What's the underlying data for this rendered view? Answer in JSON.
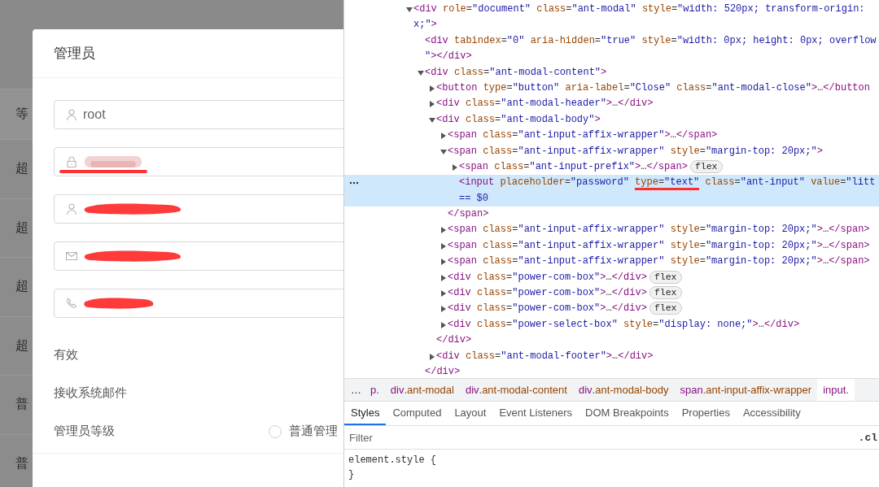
{
  "page_behind": {
    "header_cell": "等",
    "row_cells": [
      "超",
      "超",
      "超",
      "超",
      "普",
      "普"
    ]
  },
  "modal": {
    "title": "管理员",
    "fields": [
      {
        "kind": "user",
        "value": "root",
        "redacted": false,
        "underlined": false
      },
      {
        "kind": "lock",
        "redacted": true,
        "underlined": true
      },
      {
        "kind": "user",
        "redacted": true,
        "underlined": false
      },
      {
        "kind": "mail",
        "redacted": true,
        "underlined": false
      },
      {
        "kind": "phone",
        "redacted": true,
        "underlined": false
      }
    ],
    "options": [
      {
        "label": "有效"
      },
      {
        "label": "接收系统邮件"
      }
    ],
    "level": {
      "label": "管理员等级",
      "radios": [
        {
          "label": "普通管理",
          "checked": false
        }
      ]
    }
  },
  "devtools": {
    "dom_tree": [
      {
        "expanded": true,
        "selected": false,
        "lines": [
          [
            {
              "text": "<div role=\"document\" class=\"ant-modal\" style=\"width: 520px; transform-origin: ",
              "underlined": false
            }
          ],
          [
            {
              "text": "x;\">",
              "underlined": false
            }
          ]
        ],
        "children": [
          {
            "selected": false,
            "lines": [
              [
                {
                  "text": "<div tabindex=\"0\" aria-hidden=\"true\" style=\"width: 0px; height: 0px; overflow",
                  "underlined": false
                }
              ],
              [
                {
                  "text": "\"></div>",
                  "underlined": false
                }
              ]
            ]
          },
          {
            "expanded": true,
            "selected": false,
            "lines": [
              [
                {
                  "text": "<div class=\"ant-modal-content\">",
                  "underlined": false
                }
              ]
            ],
            "closing": "</div>",
            "children": [
              {
                "expanded": false,
                "selected": false,
                "lines": [
                  [
                    {
                      "text": "<button type=\"button\" aria-label=\"Close\" class=\"ant-modal-close\">…</button",
                      "underlined": false
                    }
                  ]
                ]
              },
              {
                "expanded": false,
                "selected": false,
                "lines": [
                  [
                    {
                      "text": "<div class=\"ant-modal-header\">…</div>",
                      "underlined": false
                    }
                  ]
                ]
              },
              {
                "expanded": true,
                "selected": false,
                "lines": [
                  [
                    {
                      "text": "<div class=\"ant-modal-body\">",
                      "underlined": false
                    }
                  ]
                ],
                "closing": "</div>",
                "children": [
                  {
                    "expanded": false,
                    "selected": false,
                    "lines": [
                      [
                        {
                          "text": "<span class=\"ant-input-affix-wrapper\">…</span>",
                          "underlined": false
                        }
                      ]
                    ]
                  },
                  {
                    "expanded": true,
                    "selected": false,
                    "lines": [
                      [
                        {
                          "text": "<span class=\"ant-input-affix-wrapper\" style=\"margin-top: 20px;\">",
                          "underlined": false
                        }
                      ]
                    ],
                    "closing": "</span>",
                    "children": [
                      {
                        "expanded": false,
                        "selected": false,
                        "badge": "flex",
                        "lines": [
                          [
                            {
                              "text": "<span class=\"ant-input-prefix\">…</span>",
                              "underlined": false
                            }
                          ]
                        ]
                      },
                      {
                        "selected": true,
                        "lines": [
                          [
                            {
                              "text": "<input placeholder=\"password\" ",
                              "underlined": false
                            },
                            {
                              "text": "type=\"text\"",
                              "underlined": true
                            },
                            {
                              "text": " class=\"ant-input\" value=\"litt",
                              "underlined": false
                            }
                          ],
                          [
                            {
                              "text": "== $0",
                              "underlined": false
                            }
                          ]
                        ]
                      }
                    ]
                  },
                  {
                    "expanded": false,
                    "selected": false,
                    "lines": [
                      [
                        {
                          "text": "<span class=\"ant-input-affix-wrapper\" style=\"margin-top: 20px;\">…</span>",
                          "underlined": false
                        }
                      ]
                    ]
                  },
                  {
                    "expanded": false,
                    "selected": false,
                    "lines": [
                      [
                        {
                          "text": "<span class=\"ant-input-affix-wrapper\" style=\"margin-top: 20px;\">…</span>",
                          "underlined": false
                        }
                      ]
                    ]
                  },
                  {
                    "expanded": false,
                    "selected": false,
                    "lines": [
                      [
                        {
                          "text": "<span class=\"ant-input-affix-wrapper\" style=\"margin-top: 20px;\">…</span>",
                          "underlined": false
                        }
                      ]
                    ]
                  },
                  {
                    "expanded": false,
                    "selected": false,
                    "badge": "flex",
                    "lines": [
                      [
                        {
                          "text": "<div class=\"power-com-box\">…</div>",
                          "underlined": false
                        }
                      ]
                    ]
                  },
                  {
                    "expanded": false,
                    "selected": false,
                    "badge": "flex",
                    "lines": [
                      [
                        {
                          "text": "<div class=\"power-com-box\">…</div>",
                          "underlined": false
                        }
                      ]
                    ]
                  },
                  {
                    "expanded": false,
                    "selected": false,
                    "badge": "flex",
                    "lines": [
                      [
                        {
                          "text": "<div class=\"power-com-box\">…</div>",
                          "underlined": false
                        }
                      ]
                    ]
                  },
                  {
                    "expanded": false,
                    "selected": false,
                    "lines": [
                      [
                        {
                          "text": "<div class=\"power-select-box\" style=\"display: none;\">…</div>",
                          "underlined": false
                        }
                      ]
                    ]
                  }
                ]
              },
              {
                "expanded": false,
                "selected": false,
                "lines": [
                  [
                    {
                      "text": "<div class=\"ant-modal-footer\">…</div>",
                      "underlined": false
                    }
                  ]
                ]
              }
            ]
          }
        ]
      }
    ],
    "breadcrumbs": [
      {
        "text": "…",
        "selected": false
      },
      {
        "text": "p.",
        "selected": false
      },
      {
        "text": "div.ant-modal",
        "selected": false
      },
      {
        "text": "div.ant-modal-content",
        "selected": false
      },
      {
        "text": "div.ant-modal-body",
        "selected": false
      },
      {
        "text": "span.ant-input-affix-wrapper",
        "selected": false
      },
      {
        "text": "input.",
        "selected": true
      }
    ],
    "tabs": [
      {
        "label": "Styles",
        "selected": true
      },
      {
        "label": "Computed",
        "selected": false
      },
      {
        "label": "Layout",
        "selected": false
      },
      {
        "label": "Event Listeners",
        "selected": false
      },
      {
        "label": "DOM Breakpoints",
        "selected": false
      },
      {
        "label": "Properties",
        "selected": false
      },
      {
        "label": "Accessibility",
        "selected": false
      }
    ],
    "filter": {
      "placeholder": "Filter",
      "class_toggle": ".cl"
    },
    "rule": {
      "selector": "element.style {",
      "close": "}"
    }
  }
}
